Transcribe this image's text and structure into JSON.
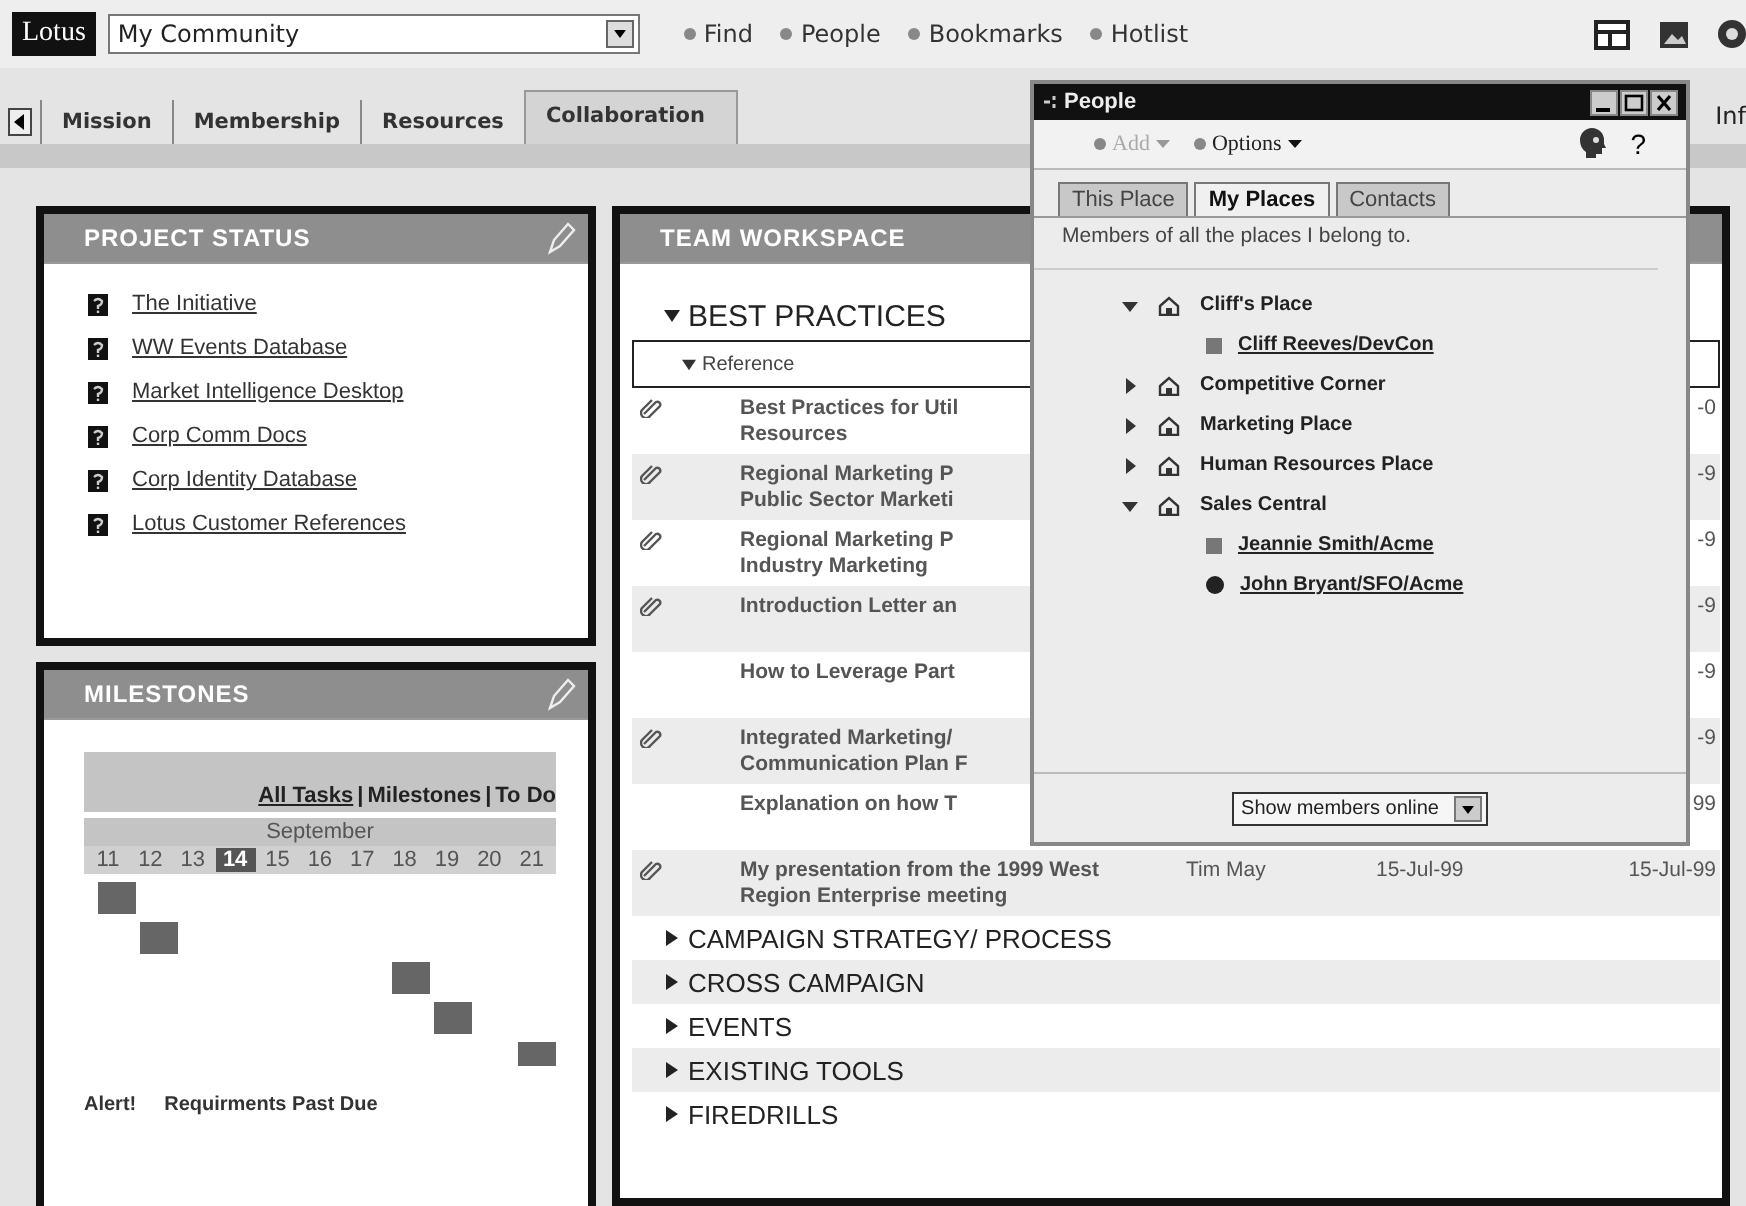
{
  "top_bar": {
    "logo": "Lotus",
    "community_select": {
      "value": "My Community"
    },
    "links": [
      "Find",
      "People",
      "Bookmarks",
      "Hotlist"
    ]
  },
  "tabs": [
    {
      "label": "Mission",
      "selected": false
    },
    {
      "label": "Membership",
      "selected": false
    },
    {
      "label": "Resources",
      "selected": false
    },
    {
      "label": "Collaboration",
      "selected": true
    }
  ],
  "tabs_overflow_label": "Inf",
  "project_status": {
    "title": "PROJECT STATUS",
    "items": [
      "The Initiative",
      "WW Events Database",
      "Market Intelligence Desktop",
      "Corp Comm Docs",
      "Corp Identity Database",
      "Lotus Customer References"
    ]
  },
  "milestones": {
    "title": "MILESTONES",
    "views": [
      {
        "label": "All Tasks",
        "selected": true
      },
      {
        "label": "Milestones",
        "selected": false
      },
      {
        "label": "To Do",
        "selected": false
      }
    ],
    "view_separators": [
      "|",
      "|"
    ],
    "month": "September",
    "days": [
      {
        "label": "11",
        "selected": false
      },
      {
        "label": "12",
        "selected": false
      },
      {
        "label": "13",
        "selected": false
      },
      {
        "label": "14",
        "selected": true
      },
      {
        "label": "15",
        "selected": false
      },
      {
        "label": "16",
        "selected": false
      },
      {
        "label": "17",
        "selected": false
      },
      {
        "label": "18",
        "selected": false
      },
      {
        "label": "19",
        "selected": false
      },
      {
        "label": "20",
        "selected": false
      },
      {
        "label": "21",
        "selected": false
      }
    ],
    "alert_label": "Alert!",
    "alert_text": "Requirments Past Due"
  },
  "team_workspace": {
    "title": "TEAM WORKSPACE",
    "sections": [
      {
        "label": "BEST PRACTICES",
        "expanded": true,
        "subsection": {
          "label": "Reference",
          "expanded": true
        },
        "rows": [
          {
            "linked": true,
            "title": [
              "Best Practices for Util",
              "Resources"
            ],
            "modified": "-0"
          },
          {
            "linked": true,
            "title": [
              "Regional Marketing P",
              "Public Sector Marketi"
            ],
            "modified": "-9"
          },
          {
            "linked": true,
            "title": [
              "Regional Marketing P",
              "Industry Marketing"
            ],
            "modified": "-9"
          },
          {
            "linked": true,
            "title": [
              "Introduction Letter an"
            ],
            "modified": "-9"
          },
          {
            "linked": false,
            "title": [
              "How to Leverage Part"
            ],
            "modified": "-9"
          },
          {
            "linked": true,
            "title": [
              "Integrated Marketing/",
              "Communication Plan F"
            ],
            "modified": "-9"
          },
          {
            "linked": false,
            "title": [
              "Explanation on how T"
            ],
            "modified": "99"
          },
          {
            "linked": true,
            "title": [
              "My presentation from the 1999 West",
              "Region Enterprise meeting"
            ],
            "author": "Tim May",
            "created": "15-Jul-99",
            "modified": "15-Jul-99"
          }
        ]
      },
      {
        "label": "CAMPAIGN STRATEGY/ PROCESS",
        "expanded": false
      },
      {
        "label": "CROSS CAMPAIGN",
        "expanded": false
      },
      {
        "label": "EVENTS",
        "expanded": false
      },
      {
        "label": "EXISTING TOOLS",
        "expanded": false
      },
      {
        "label": "FIREDRILLS",
        "expanded": false
      }
    ]
  },
  "people_window": {
    "title": "People",
    "toolbar": [
      {
        "label": "Add",
        "disabled": true
      },
      {
        "label": "Options",
        "disabled": false
      }
    ],
    "help": "?",
    "tabs": [
      {
        "label": "This Place",
        "selected": false
      },
      {
        "label": "My Places",
        "selected": true
      },
      {
        "label": "Contacts",
        "selected": false
      }
    ],
    "description": "Members of all the places I belong to.",
    "places": [
      {
        "name": "Cliff's Place",
        "expanded": true,
        "children": [
          {
            "name": "Cliff Reeves/DevCon",
            "online": false
          }
        ]
      },
      {
        "name": "Competitive Corner",
        "expanded": false
      },
      {
        "name": "Marketing Place",
        "expanded": false
      },
      {
        "name": "Human Resources Place",
        "expanded": false
      },
      {
        "name": "Sales Central",
        "expanded": true,
        "children": [
          {
            "name": "Jeannie Smith/Acme",
            "online": false
          },
          {
            "name": "John Bryant/SFO/Acme",
            "online": true
          }
        ]
      }
    ],
    "filter_select": {
      "value": "Show members online"
    }
  }
}
